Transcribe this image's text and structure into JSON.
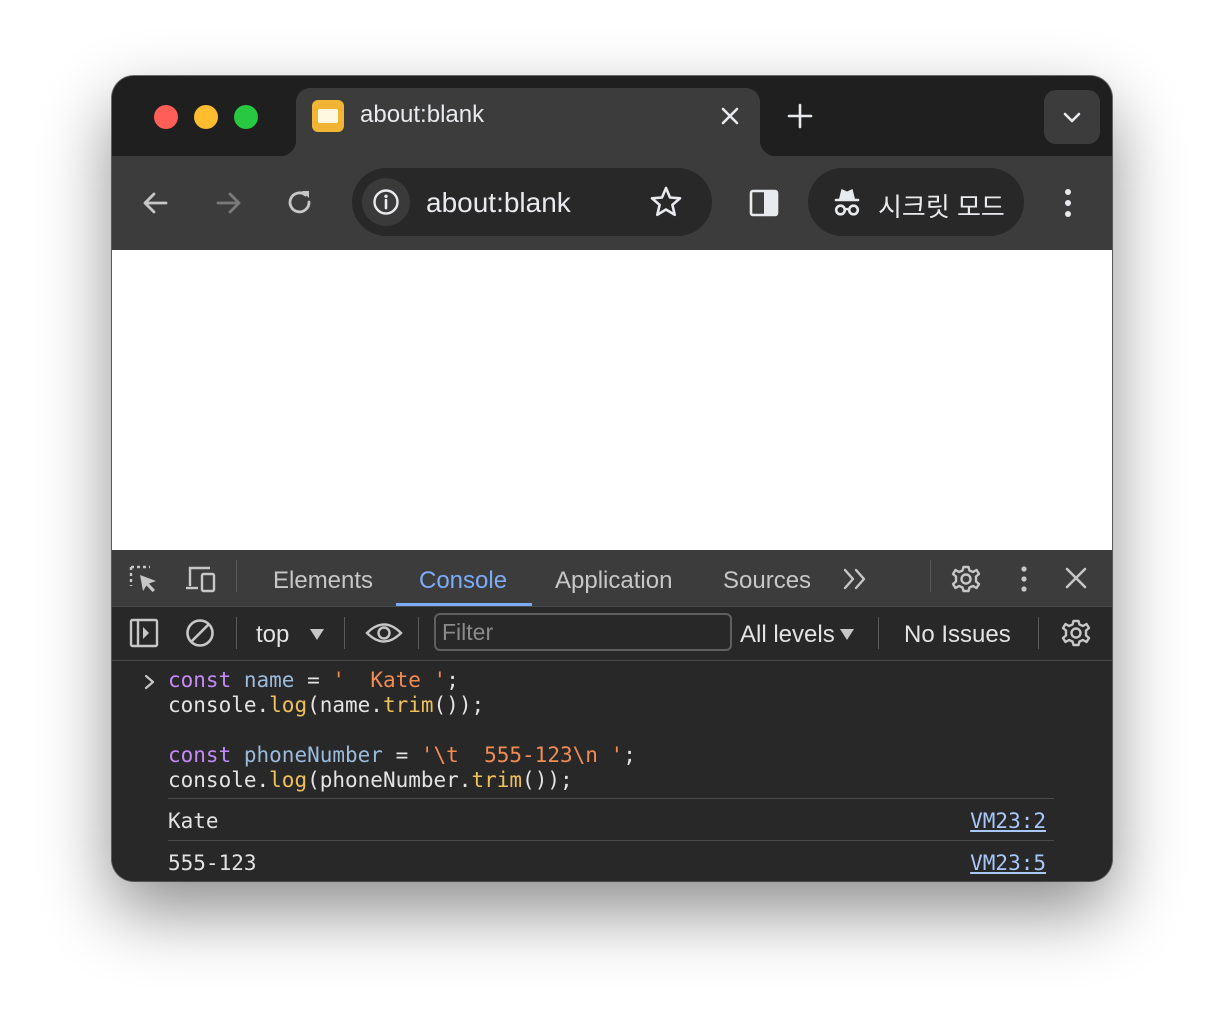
{
  "tab": {
    "title": "about:blank",
    "close_icon": "close-icon",
    "favicon": "page-favicon"
  },
  "toolbar": {
    "address": "about:blank",
    "incognito_label": "시크릿 모드"
  },
  "devtools": {
    "tabs": [
      "Elements",
      "Console",
      "Application",
      "Sources"
    ],
    "active_tab": "Console",
    "context": "top",
    "filter_placeholder": "Filter",
    "levels": "All levels",
    "issues": "No Issues"
  },
  "console": {
    "input_lines": [
      [
        {
          "t": "const",
          "c": "kw"
        },
        {
          "t": " ",
          "c": ""
        },
        {
          "t": "name",
          "c": "var"
        },
        {
          "t": " = ",
          "c": ""
        },
        {
          "t": "'  Kate '",
          "c": "str"
        },
        {
          "t": ";",
          "c": ""
        }
      ],
      [
        {
          "t": "console.",
          "c": ""
        },
        {
          "t": "log",
          "c": "fn"
        },
        {
          "t": "(name.",
          "c": ""
        },
        {
          "t": "trim",
          "c": "fn"
        },
        {
          "t": "());",
          "c": ""
        }
      ],
      [],
      [
        {
          "t": "const",
          "c": "kw"
        },
        {
          "t": " ",
          "c": ""
        },
        {
          "t": "phoneNumber",
          "c": "var"
        },
        {
          "t": " = ",
          "c": ""
        },
        {
          "t": "'\\t  555-123\\n '",
          "c": "str"
        },
        {
          "t": ";",
          "c": ""
        }
      ],
      [
        {
          "t": "console.",
          "c": ""
        },
        {
          "t": "log",
          "c": "fn"
        },
        {
          "t": "(phoneNumber.",
          "c": ""
        },
        {
          "t": "trim",
          "c": "fn"
        },
        {
          "t": "());",
          "c": ""
        }
      ]
    ],
    "outputs": [
      {
        "text": "Kate",
        "source": "VM23:2"
      },
      {
        "text": "555-123",
        "source": "VM23:5"
      }
    ]
  },
  "colors": {
    "keyword": "#c58af9",
    "variable": "#9bbbdc",
    "string": "#f28b54",
    "function": "#f0c05a",
    "active_tab": "#7cacf8",
    "link": "#a8c7fa"
  }
}
